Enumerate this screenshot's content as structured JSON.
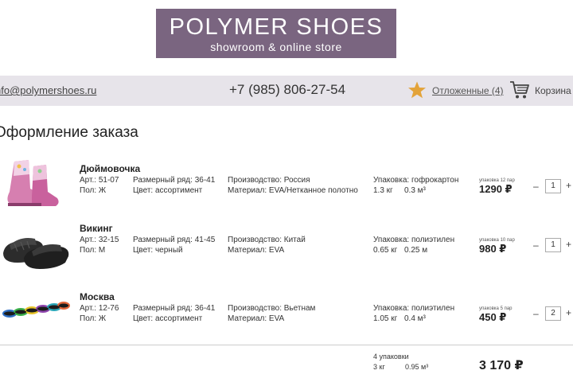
{
  "logo": {
    "title": "POLYMER SHOES",
    "subtitle": "showroom & online store"
  },
  "header": {
    "email": "nfo@polymershoes.ru",
    "phone": "+7 (985) 806-27-54",
    "saved": "Отложенные (4)",
    "cart": "Корзина (",
    "accent_color": "#e3a33a"
  },
  "page": {
    "title": "Оформление заказа"
  },
  "items": [
    {
      "name": "Дюймовочка",
      "article": "Арт.: 51-07",
      "gender": "Пол: Ж",
      "size_range": "Размерный ряд: 36-41",
      "color": "Цвет: ассортимент",
      "production": "Производство: Россия",
      "material": "Материал: EVA/Нетканное полотно",
      "packaging": "Упаковка: гофрокартон",
      "weight": "1.3 кг",
      "volume": "0.3 м³",
      "pack_label": "упаковка 12 пар",
      "price": "1290 ₽",
      "qty": "1",
      "image": "pink-kids-boots"
    },
    {
      "name": "Викинг",
      "article": "Арт.: 32-15",
      "gender": "Пол: М",
      "size_range": "Размерный ряд: 41-45",
      "color": "Цвет: черный",
      "production": "Производство: Китай",
      "material": "Материал: EVA",
      "packaging": "Упаковка: полиэтилен",
      "weight": "0.65 кг",
      "volume": "0.25 м",
      "pack_label": "упаковка 10 пар",
      "price": "980 ₽",
      "qty": "1",
      "image": "black-slides"
    },
    {
      "name": "Москва",
      "article": "Арт.: 12-76",
      "gender": "Пол: Ж",
      "size_range": "Размерный ряд: 36-41",
      "color": "Цвет: ассортимент",
      "production": "Производство: Вьетнам",
      "material": "Материал: EVA",
      "packaging": "Упаковка: полиэтилен",
      "weight": "1.05 кг",
      "volume": "0.4 м³",
      "pack_label": "упаковка 5 пар",
      "price": "450 ₽",
      "qty": "2",
      "image": "colorful-sandals"
    }
  ],
  "controls": {
    "minus": "–",
    "plus": "+"
  },
  "summary": {
    "packs": "4 упаковки",
    "weight": "3 кг",
    "volume": "0.95 м³",
    "total": "3 170 ₽"
  }
}
